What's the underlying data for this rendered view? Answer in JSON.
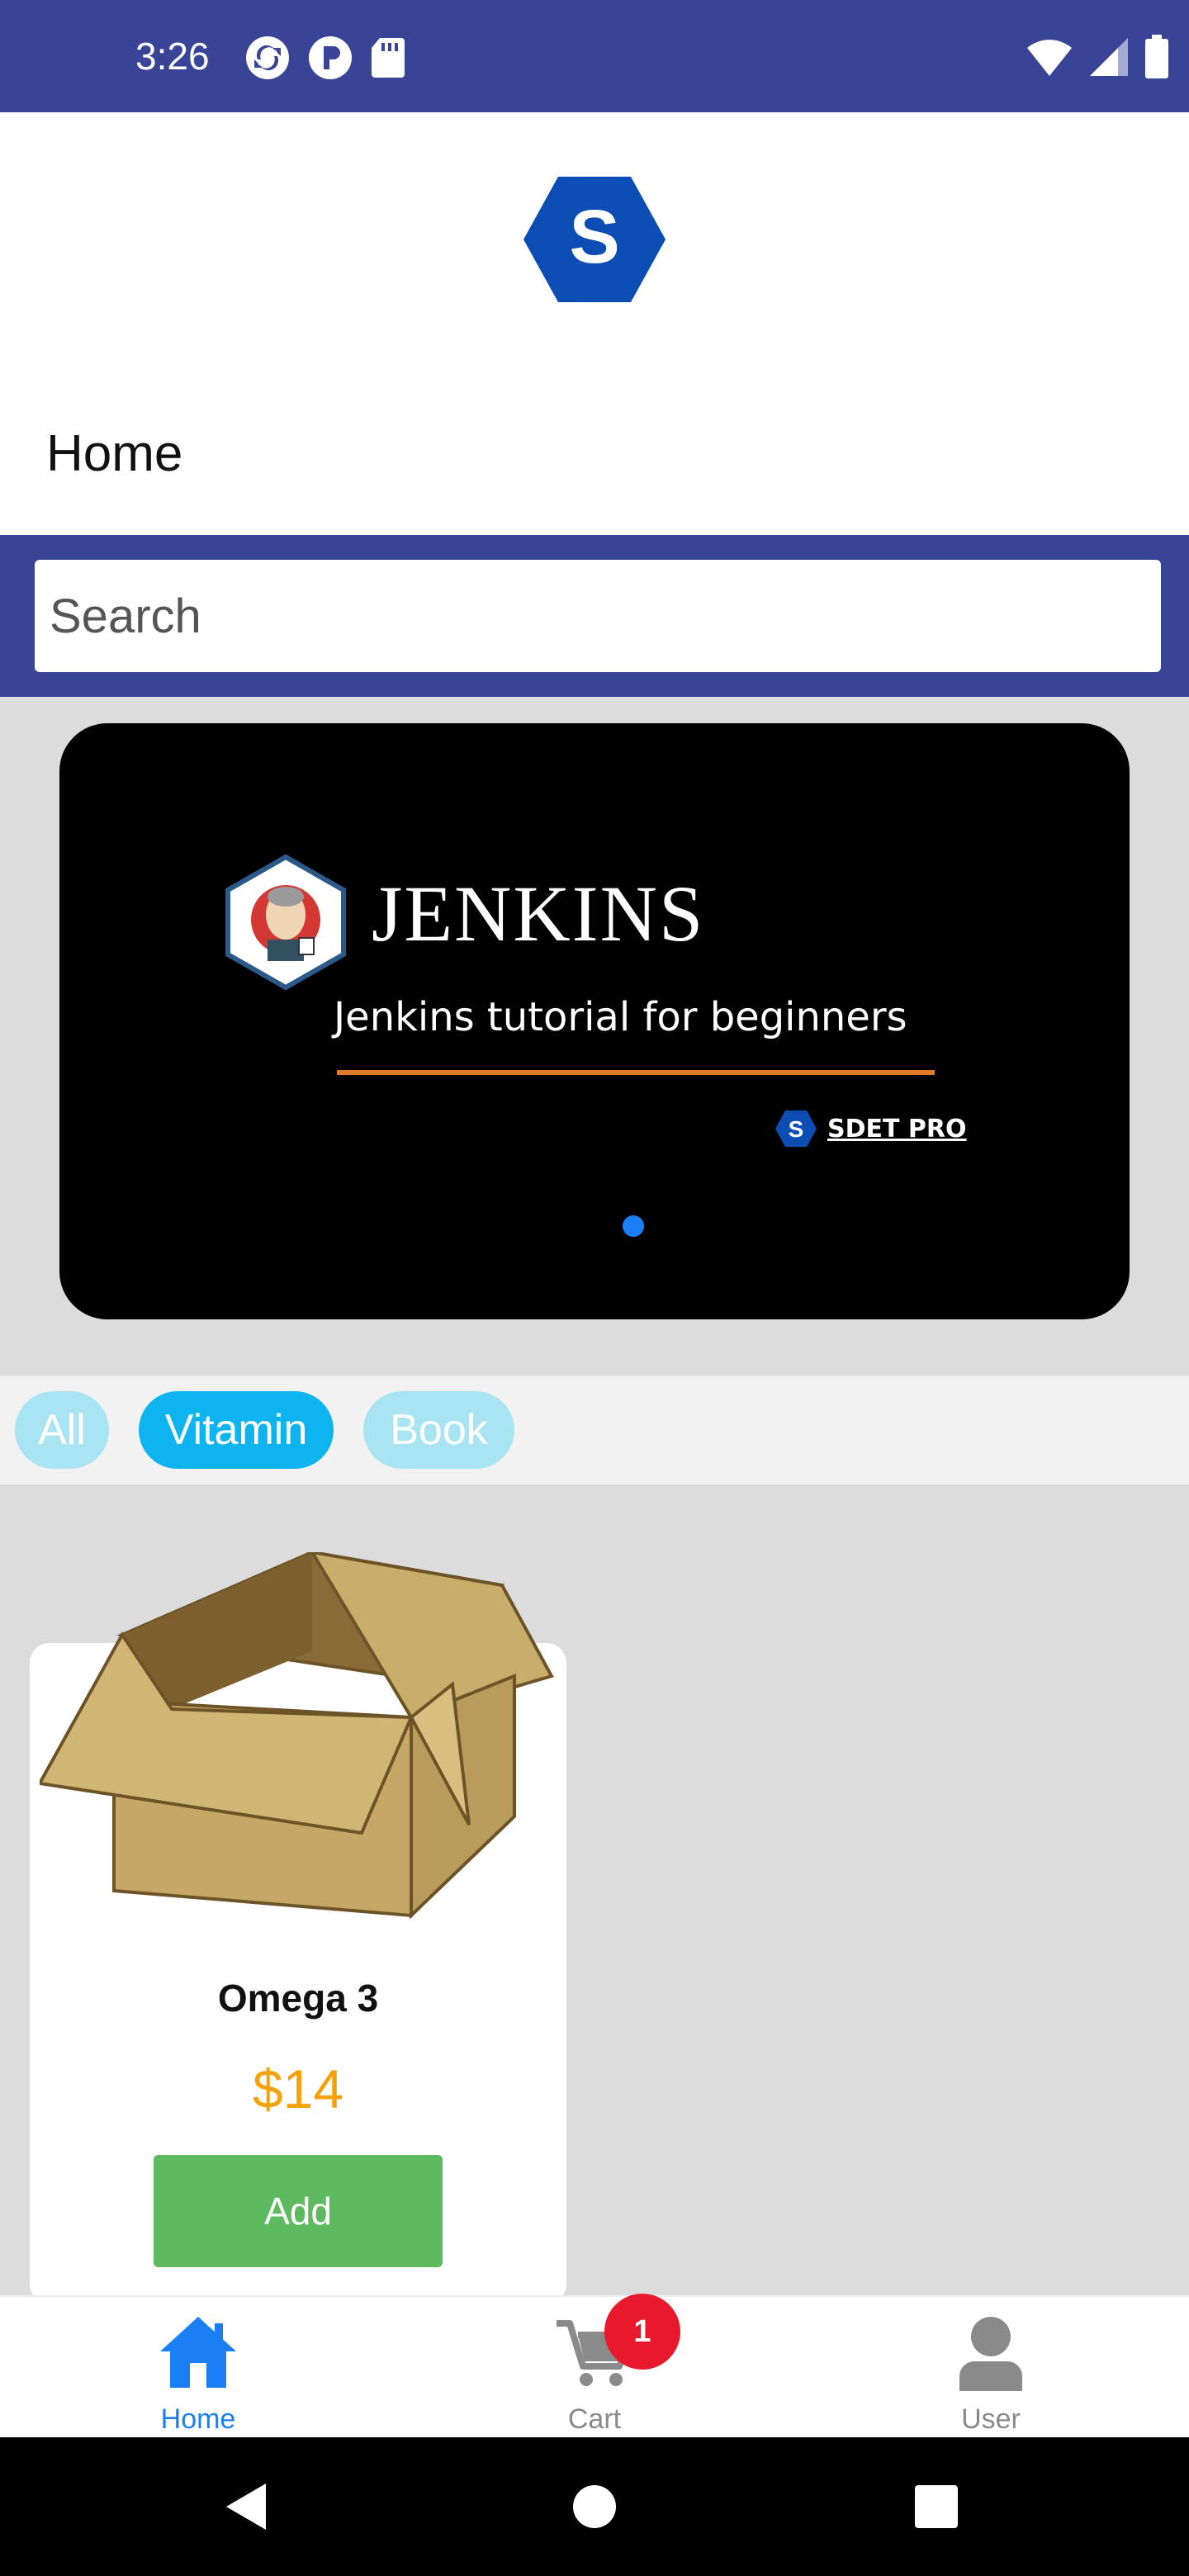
{
  "status_bar": {
    "time": "3:26",
    "left_icons": [
      "sync-icon",
      "p-circle-icon",
      "sd-card-icon"
    ],
    "right_icons": [
      "wifi-icon",
      "signal-icon",
      "battery-icon"
    ]
  },
  "header": {
    "logo_letter": "S",
    "title": "Home"
  },
  "search": {
    "placeholder": "Search",
    "value": ""
  },
  "carousel": {
    "banner_title": "JENKINS",
    "banner_subtitle": "Jenkins tutorial for beginners",
    "brand_letter": "S",
    "brand_text": "SDET PRO",
    "active_slide": 1,
    "slide_count": 1
  },
  "categories": {
    "items": [
      {
        "label": "All",
        "active": false
      },
      {
        "label": "Vitamin",
        "active": true
      },
      {
        "label": "Book",
        "active": false
      }
    ]
  },
  "products": [
    {
      "name": "Omega 3",
      "price": "$14",
      "button_label": "Add",
      "image": "cardboard-box"
    }
  ],
  "bottom_nav": {
    "items": [
      {
        "label": "Home",
        "icon": "home-icon",
        "active": true
      },
      {
        "label": "Cart",
        "icon": "cart-icon",
        "active": false,
        "badge": "1"
      },
      {
        "label": "User",
        "icon": "user-icon",
        "active": false
      }
    ]
  },
  "colors": {
    "primary": "#3a4497",
    "accent": "#1a7ef5",
    "chip_active": "#0eb4ef",
    "chip_inactive": "#a9e4f3",
    "price": "#f5a20a",
    "add_button": "#5dba5e",
    "badge": "#e8192c"
  }
}
